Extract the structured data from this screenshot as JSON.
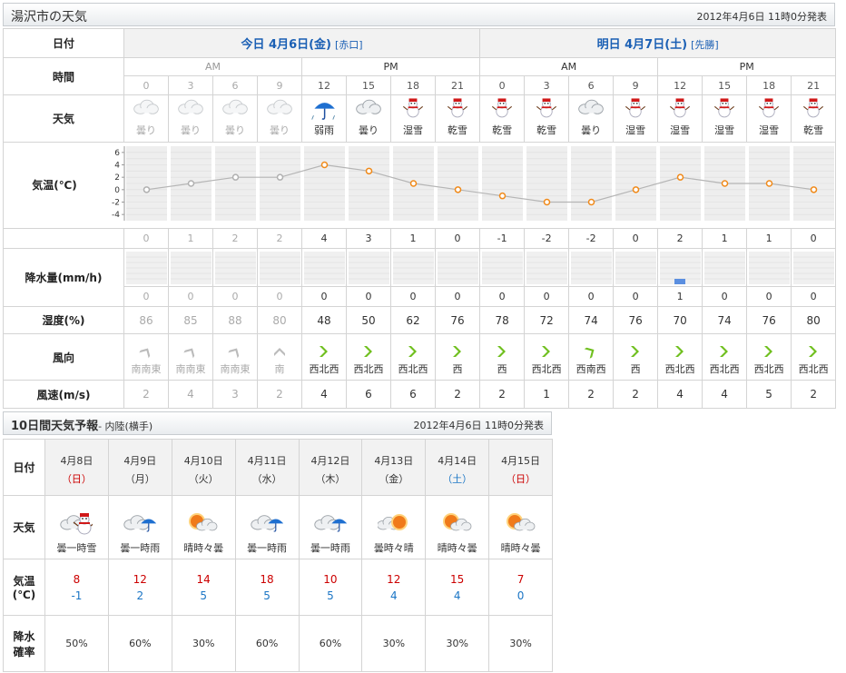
{
  "header": {
    "title": "湯沢市の天気",
    "timestamp": "2012年4月6日 11時0分発表"
  },
  "labels": {
    "date": "日付",
    "time": "時間",
    "weather": "天気",
    "temp": "気温(℃)",
    "precip": "降水量(mm/h)",
    "humidity": "湿度(%)",
    "wind_dir": "風向",
    "wind_speed": "風速(m/s)"
  },
  "days": [
    {
      "label": "今日 4月6日(金)",
      "loc": "[赤口]"
    },
    {
      "label": "明日 4月7日(土)",
      "loc": "[先勝]"
    }
  ],
  "ampm": [
    "AM",
    "PM",
    "AM",
    "PM"
  ],
  "slots": [
    {
      "hour": "0",
      "past": true,
      "weather": "曇り",
      "icon": "cloud-icon",
      "temp": "0",
      "t": 0,
      "rain": "0",
      "r": 0,
      "hum": "86",
      "wdir": "南南東",
      "wspd": "2"
    },
    {
      "hour": "3",
      "past": true,
      "weather": "曇り",
      "icon": "cloud-icon",
      "temp": "1",
      "t": 1,
      "rain": "0",
      "r": 0,
      "hum": "85",
      "wdir": "南南東",
      "wspd": "4"
    },
    {
      "hour": "6",
      "past": true,
      "weather": "曇り",
      "icon": "cloud-icon",
      "temp": "2",
      "t": 2,
      "rain": "0",
      "r": 0,
      "hum": "88",
      "wdir": "南南東",
      "wspd": "3"
    },
    {
      "hour": "9",
      "past": true,
      "weather": "曇り",
      "icon": "cloud-icon",
      "temp": "2",
      "t": 2,
      "rain": "0",
      "r": 0,
      "hum": "80",
      "wdir": "南",
      "wspd": "2"
    },
    {
      "hour": "12",
      "past": false,
      "weather": "弱雨",
      "icon": "umbrella-icon",
      "temp": "4",
      "t": 4,
      "rain": "0",
      "r": 0,
      "hum": "48",
      "wdir": "西北西",
      "wspd": "4"
    },
    {
      "hour": "15",
      "past": false,
      "weather": "曇り",
      "icon": "cloud-icon",
      "temp": "3",
      "t": 3,
      "rain": "0",
      "r": 0,
      "hum": "50",
      "wdir": "西北西",
      "wspd": "6"
    },
    {
      "hour": "18",
      "past": false,
      "weather": "湿雪",
      "icon": "snowman-icon",
      "temp": "1",
      "t": 1,
      "rain": "0",
      "r": 0,
      "hum": "62",
      "wdir": "西北西",
      "wspd": "6"
    },
    {
      "hour": "21",
      "past": false,
      "weather": "乾雪",
      "icon": "snowman-icon",
      "temp": "0",
      "t": 0,
      "rain": "0",
      "r": 0,
      "hum": "76",
      "wdir": "西",
      "wspd": "2"
    },
    {
      "hour": "0",
      "past": false,
      "weather": "乾雪",
      "icon": "snowman-icon",
      "temp": "-1",
      "t": -1,
      "rain": "0",
      "r": 0,
      "hum": "78",
      "wdir": "西",
      "wspd": "2"
    },
    {
      "hour": "3",
      "past": false,
      "weather": "乾雪",
      "icon": "snowman-icon",
      "temp": "-2",
      "t": -2,
      "rain": "0",
      "r": 0,
      "hum": "72",
      "wdir": "西北西",
      "wspd": "1"
    },
    {
      "hour": "6",
      "past": false,
      "weather": "曇り",
      "icon": "cloud-icon",
      "temp": "-2",
      "t": -2,
      "rain": "0",
      "r": 0,
      "hum": "74",
      "wdir": "西南西",
      "wspd": "2"
    },
    {
      "hour": "9",
      "past": false,
      "weather": "湿雪",
      "icon": "snowman-icon",
      "temp": "0",
      "t": 0,
      "rain": "0",
      "r": 0,
      "hum": "76",
      "wdir": "西",
      "wspd": "2"
    },
    {
      "hour": "12",
      "past": false,
      "weather": "湿雪",
      "icon": "snowman-icon",
      "temp": "2",
      "t": 2,
      "rain": "1",
      "r": 1,
      "hum": "70",
      "wdir": "西北西",
      "wspd": "4"
    },
    {
      "hour": "15",
      "past": false,
      "weather": "湿雪",
      "icon": "snowman-icon",
      "temp": "1",
      "t": 1,
      "rain": "0",
      "r": 0,
      "hum": "74",
      "wdir": "西北西",
      "wspd": "4"
    },
    {
      "hour": "18",
      "past": false,
      "weather": "湿雪",
      "icon": "snowman-icon",
      "temp": "1",
      "t": 1,
      "rain": "0",
      "r": 0,
      "hum": "76",
      "wdir": "西北西",
      "wspd": "5"
    },
    {
      "hour": "21",
      "past": false,
      "weather": "乾雪",
      "icon": "snowman-icon",
      "temp": "0",
      "t": 0,
      "rain": "0",
      "r": 0,
      "hum": "80",
      "wdir": "西北西",
      "wspd": "2"
    }
  ],
  "chart_data": {
    "type": "line",
    "ylabel": "気温(℃)",
    "ylim": [
      -5,
      7
    ],
    "yticks": [
      "6",
      "4",
      "2",
      "0",
      "-2",
      "-4"
    ],
    "x": [
      "0",
      "3",
      "6",
      "9",
      "12",
      "15",
      "18",
      "21",
      "0",
      "3",
      "6",
      "9",
      "12",
      "15",
      "18",
      "21"
    ],
    "values": [
      0,
      1,
      2,
      2,
      4,
      3,
      1,
      0,
      -1,
      -2,
      -2,
      0,
      2,
      1,
      1,
      0
    ]
  },
  "ten_day": {
    "title": "10日間天気予報",
    "region": "- 内陸(横手)",
    "timestamp": "2012年4月6日 11時0分発表",
    "labels": {
      "date": "日付",
      "weather": "天気",
      "temp1": "気温",
      "temp2": "(℃)",
      "pop1": "降水",
      "pop2": "確率"
    },
    "days": [
      {
        "date": "4月8日",
        "dow": "（日）",
        "dowtype": "sun",
        "weather": "曇一時雪",
        "icon": "cloud-snow-icon",
        "hi": "8",
        "lo": "-1",
        "pop": "50%"
      },
      {
        "date": "4月9日",
        "dow": "（月）",
        "dowtype": "",
        "weather": "曇一時雨",
        "icon": "cloud-rain-icon",
        "hi": "12",
        "lo": "2",
        "pop": "60%"
      },
      {
        "date": "4月10日",
        "dow": "（火）",
        "dowtype": "",
        "weather": "晴時々曇",
        "icon": "sun-cloud-icon",
        "hi": "14",
        "lo": "5",
        "pop": "30%"
      },
      {
        "date": "4月11日",
        "dow": "（水）",
        "dowtype": "",
        "weather": "曇一時雨",
        "icon": "cloud-rain-icon",
        "hi": "18",
        "lo": "5",
        "pop": "60%"
      },
      {
        "date": "4月12日",
        "dow": "（木）",
        "dowtype": "",
        "weather": "曇一時雨",
        "icon": "cloud-rain-icon",
        "hi": "10",
        "lo": "5",
        "pop": "60%"
      },
      {
        "date": "4月13日",
        "dow": "（金）",
        "dowtype": "",
        "weather": "曇時々晴",
        "icon": "cloud-sun-icon",
        "hi": "12",
        "lo": "4",
        "pop": "30%"
      },
      {
        "date": "4月14日",
        "dow": "（土）",
        "dowtype": "sat",
        "weather": "晴時々曇",
        "icon": "sun-cloud-icon",
        "hi": "15",
        "lo": "4",
        "pop": "30%"
      },
      {
        "date": "4月15日",
        "dow": "（日）",
        "dowtype": "sun",
        "weather": "晴時々曇",
        "icon": "sun-cloud-icon",
        "hi": "7",
        "lo": "0",
        "pop": "30%"
      }
    ]
  }
}
